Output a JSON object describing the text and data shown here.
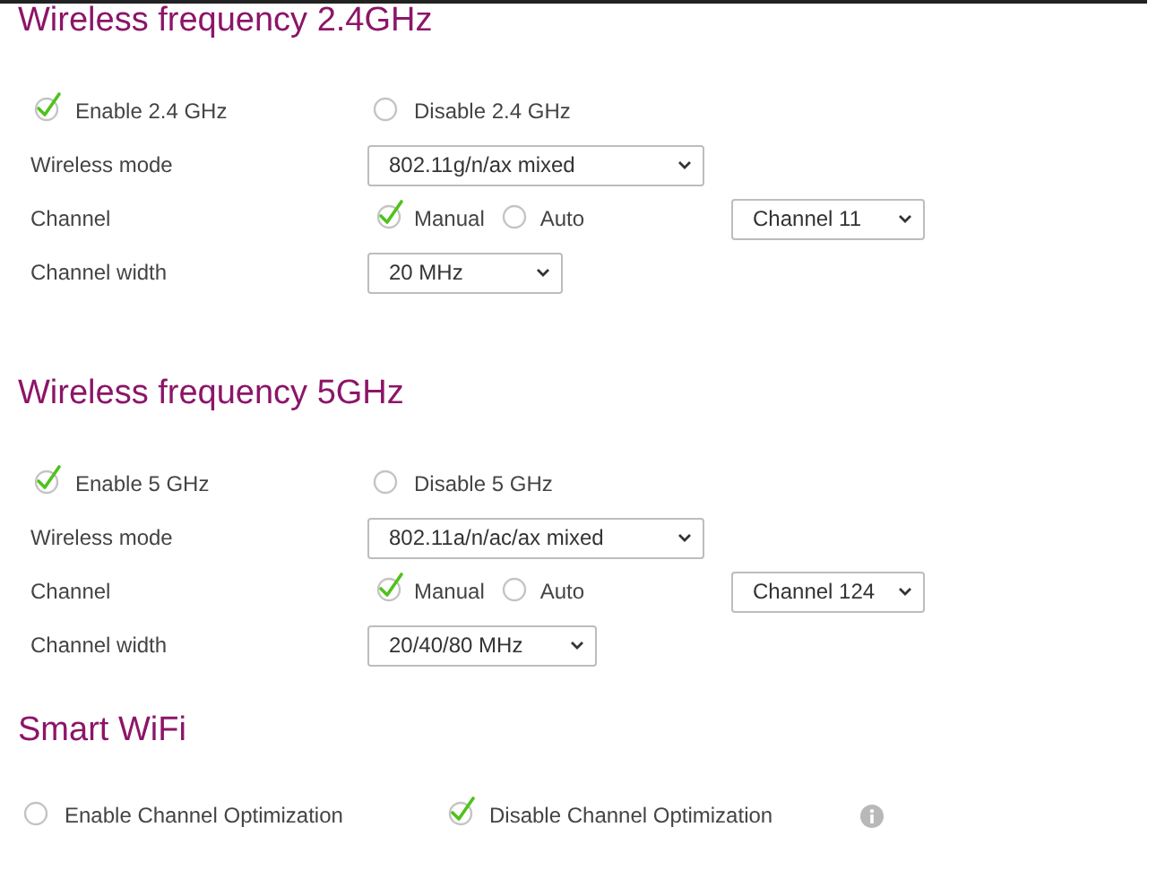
{
  "sections": [
    {
      "kind": "frequency",
      "title": "Wireless frequency 2.4GHz",
      "toggle": [
        {
          "label": "Enable 2.4 GHz",
          "selected": true
        },
        {
          "label": "Disable 2.4 GHz",
          "selected": false
        }
      ],
      "mode": {
        "label": "Wireless mode",
        "value": "802.11g/n/ax mixed"
      },
      "channel": {
        "label": "Channel",
        "options": [
          {
            "label": "Manual",
            "selected": true
          },
          {
            "label": "Auto",
            "selected": false
          }
        ],
        "value": "Channel 11"
      },
      "width": {
        "label": "Channel width",
        "value": "20 MHz"
      }
    },
    {
      "kind": "frequency",
      "title": "Wireless frequency 5GHz",
      "toggle": [
        {
          "label": "Enable 5 GHz",
          "selected": true
        },
        {
          "label": "Disable 5 GHz",
          "selected": false
        }
      ],
      "mode": {
        "label": "Wireless mode",
        "value": "802.11a/n/ac/ax mixed"
      },
      "channel": {
        "label": "Channel",
        "options": [
          {
            "label": "Manual",
            "selected": true
          },
          {
            "label": "Auto",
            "selected": false
          }
        ],
        "value": "Channel 124"
      },
      "width": {
        "label": "Channel width",
        "value": "20/40/80 MHz"
      }
    },
    {
      "kind": "smart",
      "title": "Smart WiFi",
      "toggle": [
        {
          "label": "Enable Channel Optimization",
          "selected": false
        },
        {
          "label": "Disable Channel Optimization",
          "selected": true
        }
      ]
    }
  ]
}
